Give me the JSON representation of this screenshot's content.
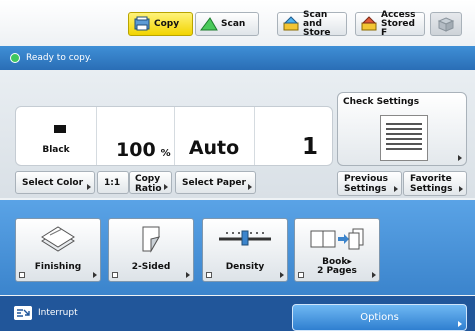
{
  "top_tabs": [
    {
      "label": "Copy",
      "active": true,
      "icon": "copy-icon"
    },
    {
      "label": "Scan",
      "active": false,
      "icon": "scan-icon"
    },
    {
      "label": "Scan and\nStore",
      "active": false,
      "icon": "scan-store-icon"
    },
    {
      "label": "Access\nStored F",
      "active": false,
      "icon": "access-stored-icon"
    }
  ],
  "status": {
    "text": "Ready to copy."
  },
  "summary": {
    "color": "Black",
    "ratio": "100",
    "ratio_unit": "%",
    "paper": "Auto",
    "copies": "1"
  },
  "check_settings": {
    "label": "Check Settings"
  },
  "row_buttons": {
    "select_color": "Select Color",
    "ratio_11": "1:1",
    "copy_ratio": "Copy\nRatio",
    "select_paper": "Select Paper",
    "previous_settings": "Previous\nSettings",
    "favorite_settings": "Favorite\nSettings"
  },
  "functions": [
    {
      "label": "Finishing",
      "icon": "finishing-icon"
    },
    {
      "label": "2-Sided",
      "icon": "two-sided-icon"
    },
    {
      "label": "Density",
      "icon": "density-icon"
    },
    {
      "label": "Book▸\n2 Pages",
      "icon": "book-to-pages-icon"
    }
  ],
  "bottom": {
    "interrupt": "Interrupt",
    "options": "Options"
  },
  "colors": {
    "active_tab": "#f2d400",
    "status_bar": "#2a6eb6",
    "function_area": "#3b84cc",
    "bottom_bar": "#21569a"
  }
}
